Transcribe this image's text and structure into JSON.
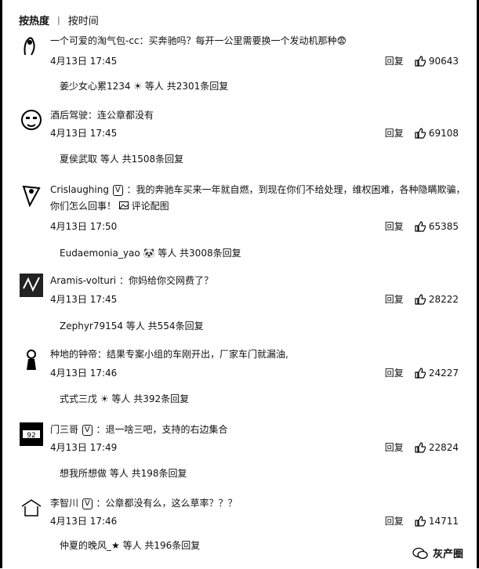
{
  "sort": {
    "hot": "按热度",
    "time": "按时间"
  },
  "reply_label": "回复",
  "comments": [
    {
      "text": "一个可爱的淘气包-cc：买奔驰吗？每开一公里需要换一个发动机那种😨",
      "date": "4月13日 17:45",
      "likes": "90643",
      "replies": "姜少女心累1234 ☀ 等人 共2301条回复"
    },
    {
      "text": "酒后驾驶：连公章都没有",
      "date": "4月13日 17:45",
      "likes": "69108",
      "replies": "夏侯武取 等人 共1508条回复"
    },
    {
      "user": "Crislaughing",
      "text": "：我的奔驰车买来一年就自燃，到现在你们不给处理，维权困难，各种隐瞒欺骗，你们怎么回事！",
      "extra": "评论配图",
      "date": "4月13日 17:50",
      "likes": "65385",
      "replies": "Eudaemonia_yao 🐼 等人 共3008条回复"
    },
    {
      "user": "Aramis-volturi",
      "text": "：你妈给你交网费了？",
      "date": "4月13日 17:45",
      "likes": "28222",
      "replies": "Zephyr79154 等人 共554条回复"
    },
    {
      "text": "种地的钟帝：结果专案小组的车刚开出，厂家车门就漏油,",
      "date": "4月13日 17:46",
      "likes": "24227",
      "replies": "式式三戊 ☀ 等人 共392条回复"
    },
    {
      "user": "门三哥",
      "text": "：退一啥三吧，支持的右边集合",
      "date": "4月13日 17:49",
      "likes": "22824",
      "replies": "想我所想做 等人 共198条回复"
    },
    {
      "user": "李智川",
      "text": "：公章都没有么，这么草率？？？",
      "date": "4月13日 17:46",
      "likes": "14711",
      "replies": "仲夏的晚风_★ 等人 共196条回复"
    }
  ],
  "footer": "灰产圈"
}
